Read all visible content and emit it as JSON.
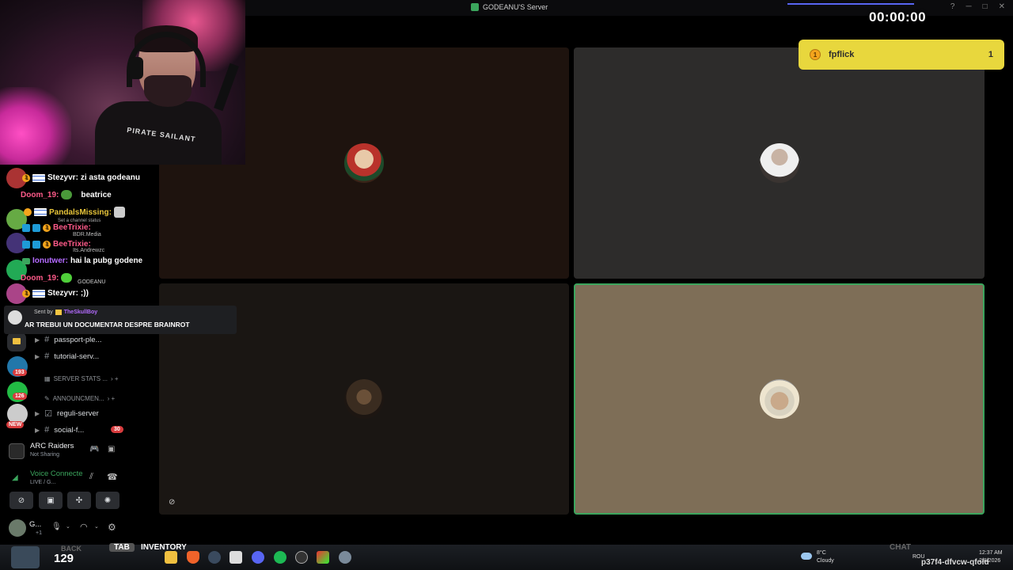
{
  "window": {
    "title": "GODEANU'S Server"
  },
  "timer": "00:00:00",
  "notification": {
    "name": "fpflick",
    "count": "1"
  },
  "webcam": {
    "shirt_text": "PIRATE SAILANT"
  },
  "chat": {
    "lines": [
      {
        "user": "Stezyvr:",
        "text": "zi asta godeanu",
        "color": "#ffffff"
      },
      {
        "user": "Doom_19:",
        "text": "beatrice",
        "color": "#ff5b8a"
      },
      {
        "user": "PandalsMissing:",
        "text": "",
        "color": "#e8c53a"
      },
      {
        "user": "BeeTrixie:",
        "text": "",
        "color": "#ff5b8a"
      },
      {
        "user": "BeeTrixie:",
        "text": "",
        "color": "#ff5b8a"
      },
      {
        "user": "Ionutwer:",
        "text": "hai la pubg godene",
        "color": "#b46bff"
      },
      {
        "user": "Doom_19:",
        "text": "",
        "color": "#ff5b8a"
      },
      {
        "user": "Stezyvr:",
        "text": ";))",
        "color": "#ffffff"
      }
    ],
    "ghost_texts": [
      "Set a channel status",
      "BDR.Media",
      "Its.Andrewzc",
      "GODEANU"
    ],
    "sent": {
      "prefix": "Sent by",
      "user": "TheSkullBoy",
      "message": "AR TREBUI UN DOCUMENTAR DESPRE BRAINROT"
    }
  },
  "channels": {
    "items": [
      {
        "label": "passport-ple...",
        "type": "text"
      },
      {
        "label": "tutorial-serv...",
        "type": "text"
      },
      {
        "label": "SERVER STATS ...",
        "type": "category"
      },
      {
        "label": "ANNOUNCMEN...",
        "type": "category"
      },
      {
        "label": "reguli-server",
        "type": "text"
      },
      {
        "label": "social-f...",
        "type": "text",
        "badge": "30"
      }
    ]
  },
  "server_rail": {
    "badges": [
      "193",
      "126"
    ],
    "new_label": "NEW"
  },
  "activity": {
    "title": "ARC Raiders",
    "subtitle": "Not Sharing"
  },
  "voice": {
    "status": "Voice Connecte",
    "detail": "LIVE / G..."
  },
  "user_panel": {
    "name": "G...",
    "sub": "+1"
  },
  "taskbar": {
    "count": "129",
    "overlay_back": "BACK",
    "overlay_tab": "TAB",
    "overlay_inventory": "INVENTORY",
    "overlay_chat": "CHAT",
    "weather_temp": "8°C",
    "weather_desc": "Cloudy",
    "lang": "ROU",
    "time": "12:37 AM",
    "date": "2/8/2026",
    "overlay_code": "p37f4-dfvcw-qfold"
  },
  "colors": {
    "speaking_border": "#3ba55d",
    "tile_1": "#1e130e",
    "tile_2": "#2d2c2b",
    "tile_3": "#1a1613",
    "tile_4": "#7e6e57",
    "notif_bg": "#e8d73d"
  }
}
